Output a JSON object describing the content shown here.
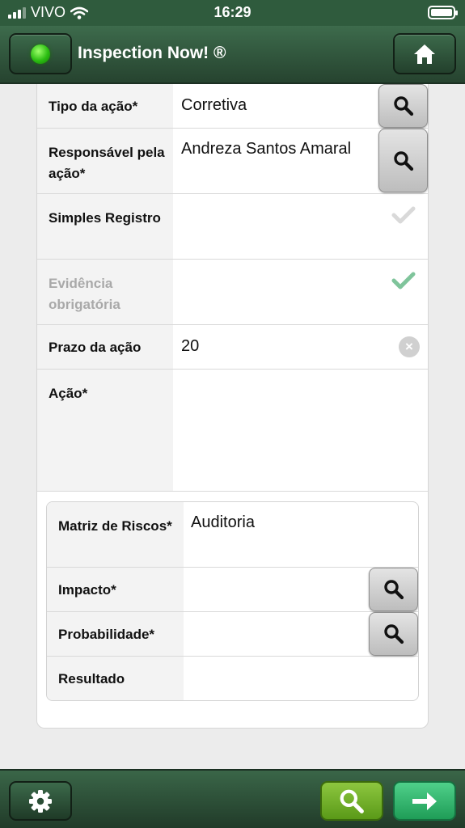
{
  "status_bar": {
    "carrier": "VIVO",
    "time": "16:29"
  },
  "header": {
    "title": "Inspection Now! ®"
  },
  "form": {
    "tipo": {
      "label": "Tipo da ação*",
      "value": "Corretiva"
    },
    "responsavel": {
      "label": "Responsável pela ação*",
      "value": "Andreza Santos Amaral"
    },
    "simples": {
      "label": "Simples Registro"
    },
    "evidencia": {
      "label": "Evidência obrigatória"
    },
    "prazo": {
      "label": "Prazo da ação",
      "value": "20"
    },
    "acao": {
      "label": "Ação*",
      "value": ""
    }
  },
  "risk": {
    "matriz": {
      "label": "Matriz de Riscos*",
      "value": "Auditoria"
    },
    "impacto": {
      "label": "Impacto*",
      "value": ""
    },
    "probabilidade": {
      "label": "Probabilidade*",
      "value": ""
    },
    "resultado": {
      "label": "Resultado",
      "value": ""
    }
  },
  "colors": {
    "header_green": "#2f5b3d",
    "check_disabled": "#d9d9d9",
    "check_enabled": "#7fc49b",
    "search_green": "#7cb82f",
    "next_green": "#2fb66a"
  },
  "icons": {
    "status": "green-led-icon",
    "home": "home-icon",
    "search": "search-icon",
    "check": "check-icon",
    "clear": "clear-icon",
    "settings": "gear-icon",
    "next": "arrow-right-icon"
  }
}
